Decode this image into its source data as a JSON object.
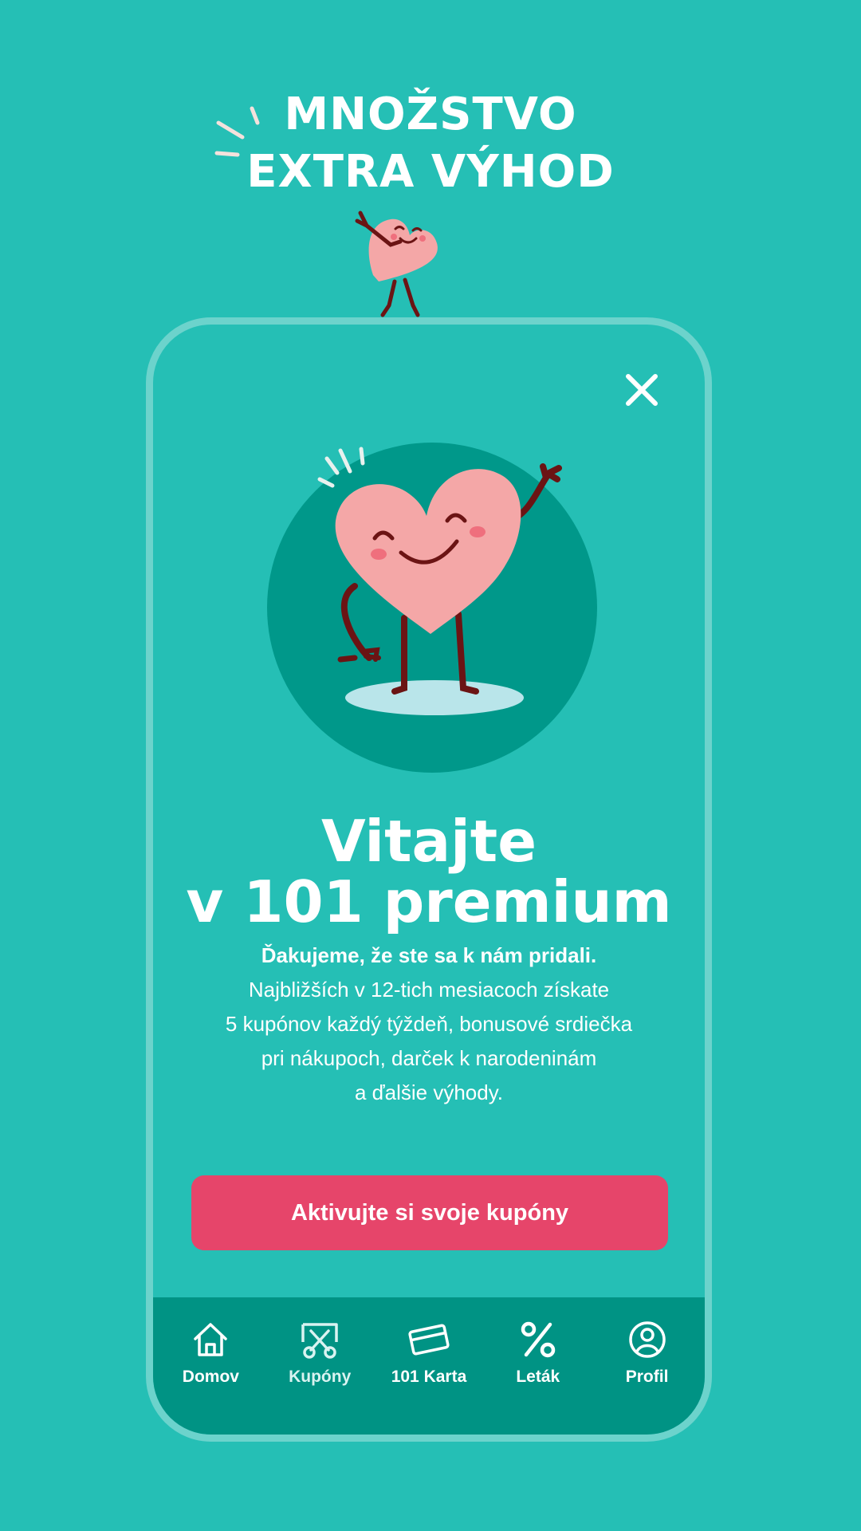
{
  "promo": {
    "headline_line1": "MNOŽSTVO",
    "headline_line2": "EXTRA VÝHOD"
  },
  "modal": {
    "title_line1": "Vitajte",
    "title_line2": "v 101 premium",
    "lead": "Ďakujeme, že ste sa k nám pridali.",
    "body_lines": [
      "Najbližších v 12-tich mesiacoch získate",
      "5 kupónov každý týždeň, bonusové srdiečka",
      "pri nákupoch, darček k narodeninám",
      "a ďalšie výhody."
    ],
    "cta_label": "Aktivujte si svoje kupóny",
    "close_icon": "close-icon",
    "hero_icon": "waving-heart-mascot"
  },
  "nav": {
    "items": [
      {
        "label": "Domov",
        "icon": "home-icon"
      },
      {
        "label": "Kupóny",
        "icon": "coupon-scissors-icon"
      },
      {
        "label": "101 Karta",
        "icon": "card-icon"
      },
      {
        "label": "Leták",
        "icon": "percent-icon"
      },
      {
        "label": "Profil",
        "icon": "profile-icon"
      }
    ]
  },
  "colors": {
    "background": "#25bfb5",
    "phone_border": "#6cd3cc",
    "navbar": "#009384",
    "cta": "#e6456a",
    "heart": "#f4a7a7",
    "hero_circle": "#00988a"
  }
}
